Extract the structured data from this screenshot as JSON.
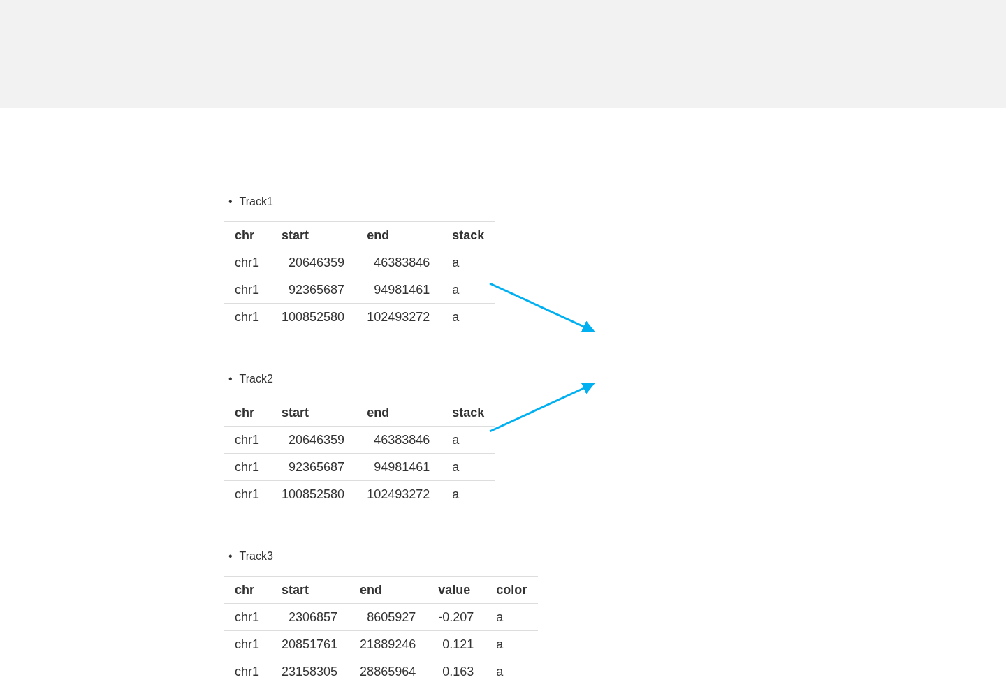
{
  "tracks": [
    {
      "marker": "•",
      "label": "Track1",
      "columns": [
        {
          "label": "chr",
          "kind": "text"
        },
        {
          "label": "start",
          "kind": "number"
        },
        {
          "label": "end",
          "kind": "number"
        },
        {
          "label": "stack",
          "kind": "text"
        }
      ],
      "rows": [
        [
          "chr1",
          "20646359",
          "46383846",
          "a"
        ],
        [
          "chr1",
          "92365687",
          "94981461",
          "a"
        ],
        [
          "chr1",
          "100852580",
          "102493272",
          "a"
        ]
      ]
    },
    {
      "marker": "•",
      "label": "Track2",
      "columns": [
        {
          "label": "chr",
          "kind": "text"
        },
        {
          "label": "start",
          "kind": "number"
        },
        {
          "label": "end",
          "kind": "number"
        },
        {
          "label": "stack",
          "kind": "text"
        }
      ],
      "rows": [
        [
          "chr1",
          "20646359",
          "46383846",
          "a"
        ],
        [
          "chr1",
          "92365687",
          "94981461",
          "a"
        ],
        [
          "chr1",
          "100852580",
          "102493272",
          "a"
        ]
      ]
    },
    {
      "marker": "•",
      "label": "Track3",
      "columns": [
        {
          "label": "chr",
          "kind": "text"
        },
        {
          "label": "start",
          "kind": "number"
        },
        {
          "label": "end",
          "kind": "number"
        },
        {
          "label": "value",
          "kind": "number"
        },
        {
          "label": "color",
          "kind": "text"
        }
      ],
      "rows": [
        [
          "chr1",
          "2306857",
          "8605927",
          "-0.207",
          "a"
        ],
        [
          "chr1",
          "20851761",
          "21889246",
          "0.121",
          "a"
        ],
        [
          "chr1",
          "23158305",
          "28865964",
          "0.163",
          "a"
        ]
      ]
    }
  ]
}
